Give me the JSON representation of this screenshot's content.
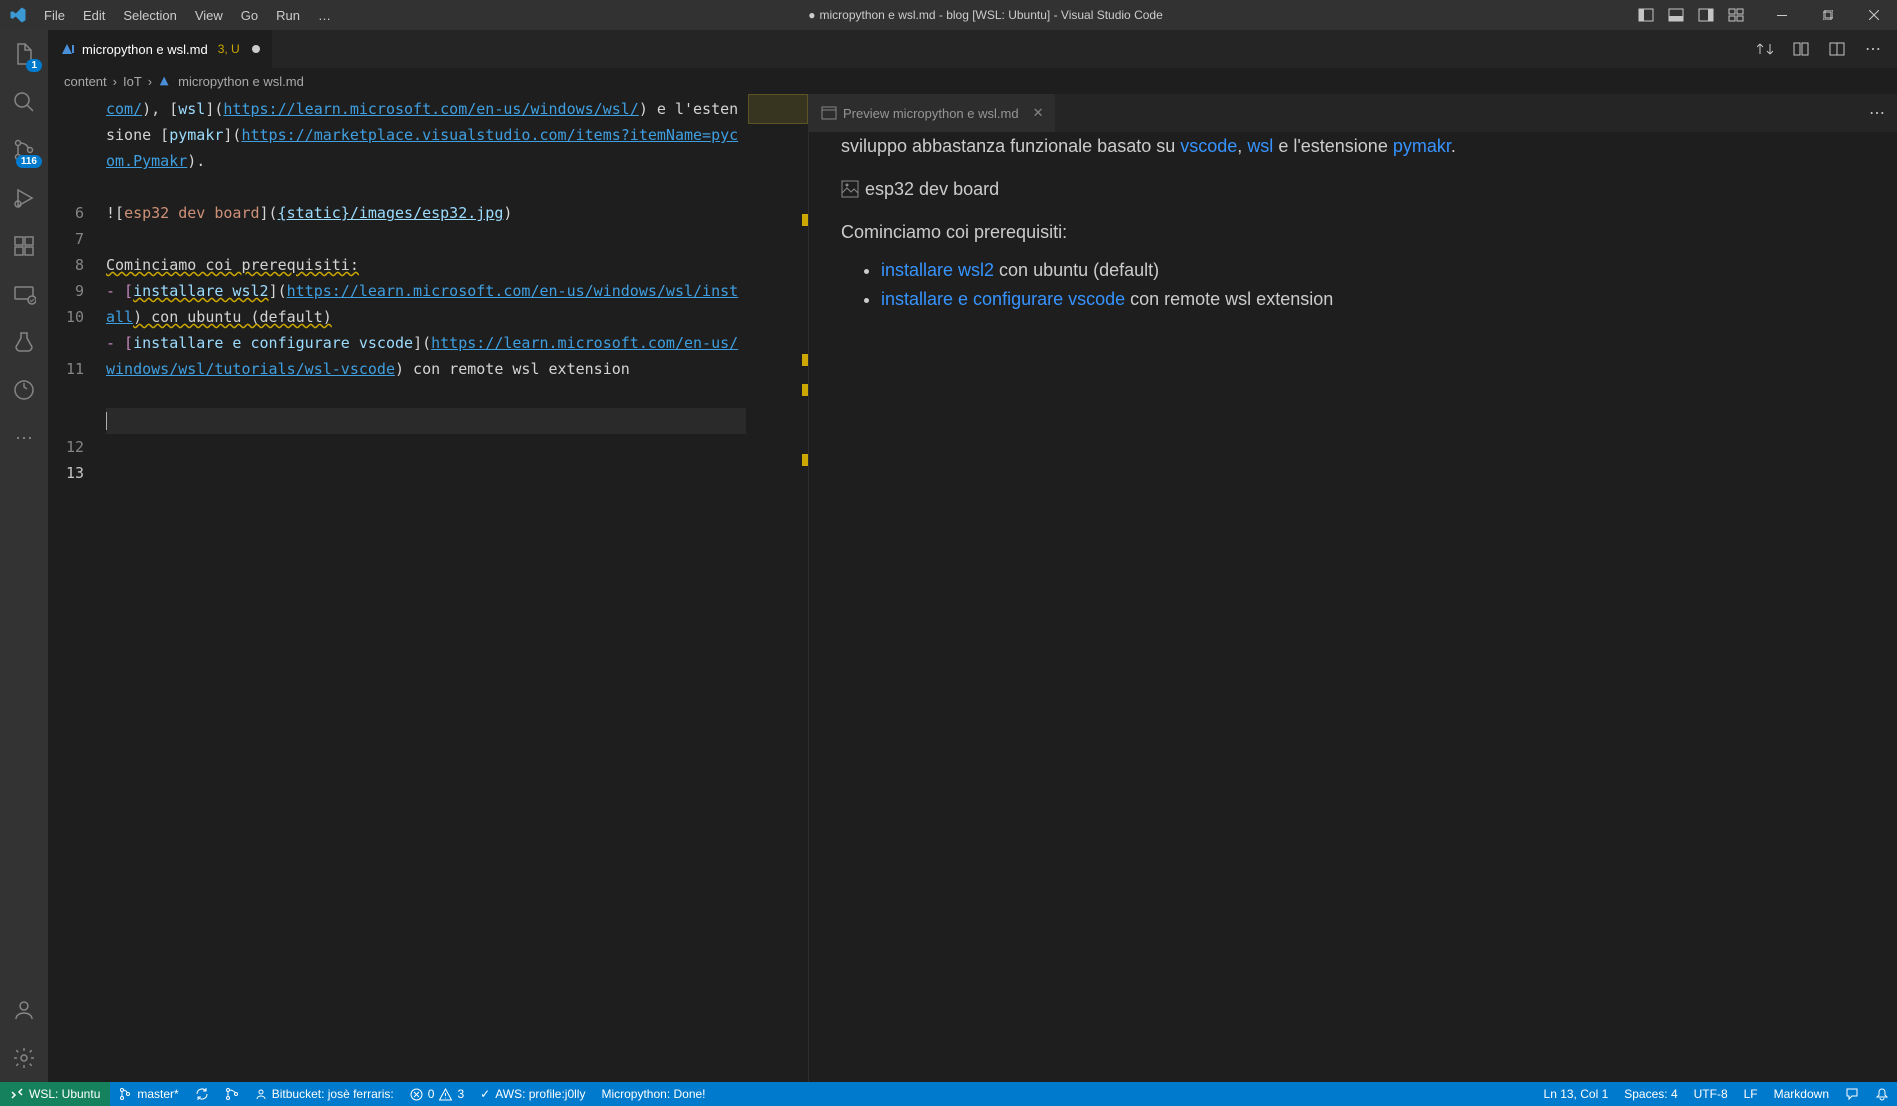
{
  "menubar": {
    "items": [
      "File",
      "Edit",
      "Selection",
      "View",
      "Go",
      "Run",
      "…"
    ],
    "title_prefix": "●",
    "title": "micropython e wsl.md - blog [WSL: Ubuntu] - Visual Studio Code"
  },
  "activitybar": {
    "explorer_badge": "1",
    "scm_badge": "116"
  },
  "editor": {
    "tab_name": "micropython e wsl.md",
    "tab_badge": "3, U",
    "breadcrumb": [
      "content",
      "IoT",
      "micropython e wsl.md"
    ],
    "lines": {
      "5a": "com/",
      "5b": "), [",
      "5c": "wsl",
      "5d": "](",
      "5e": "https://learn.microsoft.com/en-us/windows/wsl/",
      "5f": ") e l'estensione [",
      "5g": "pymakr",
      "5h": "](",
      "5i": "https://marketplace.visualstudio.com/items?itemName=pycom.Pymakr",
      "5j": ").",
      "7a": "![",
      "7b": "esp32 dev board",
      "7c": "](",
      "7d": "{static}/images/esp32.jpg",
      "7e": ")",
      "9": "Cominciamo coi prerequisiti:",
      "10a": "- [",
      "10b": "installare wsl2",
      "10c": "](",
      "10d": "https://learn.microsoft.com/en-us/windows/wsl/install",
      "10e": ") con ubuntu (default)",
      "11a": "- [",
      "11b": "installare e configurare vscode",
      "11c": "](",
      "11d": "https://learn.microsoft.com/en-us/windows/wsl/tutorials/wsl-vscode",
      "11e": ") con remote wsl extension"
    },
    "line_numbers": [
      "",
      "6",
      "7",
      "8",
      "9",
      "10",
      "11",
      "12",
      "13"
    ]
  },
  "preview": {
    "tab_name": "Preview micropython e wsl.md",
    "para1_a": "sviluppo abbastanza funzionale basato su ",
    "para1_vscode": "vscode",
    "para1_b": ", ",
    "para1_wsl": "wsl",
    "para1_c": " e l'estensione ",
    "para1_pymakr": "pymakr",
    "para1_d": ".",
    "img_alt": "esp32 dev board",
    "para2": "Cominciamo coi prerequisiti:",
    "li1_link": "installare wsl2",
    "li1_rest": " con ubuntu (default)",
    "li2_link": "installare e configurare vscode",
    "li2_rest": " con remote wsl extension"
  },
  "statusbar": {
    "remote": "WSL: Ubuntu",
    "branch": "master*",
    "bitbucket": "Bitbucket: josè ferraris:",
    "errors": "0",
    "warnings": "3",
    "aws": "AWS: profile:j0lly",
    "micropython": "Micropython: Done!",
    "position": "Ln 13, Col 1",
    "spaces": "Spaces: 4",
    "encoding": "UTF-8",
    "eol": "LF",
    "lang": "Markdown"
  }
}
